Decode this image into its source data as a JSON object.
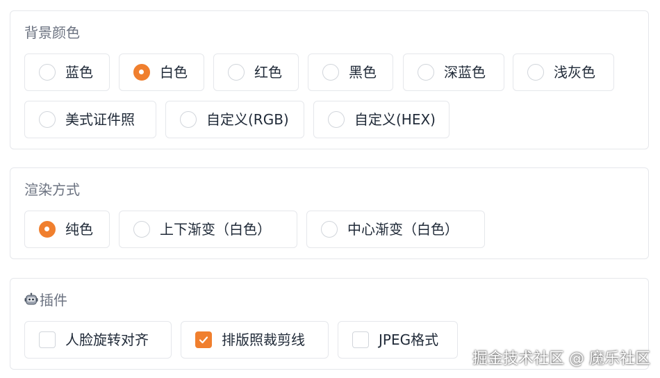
{
  "background_color": {
    "title": "背景颜色",
    "options": [
      "蓝色",
      "白色",
      "红色",
      "黑色",
      "深蓝色",
      "浅灰色",
      "美式证件照",
      "自定义(RGB)",
      "自定义(HEX)"
    ],
    "selected": "白色"
  },
  "render_mode": {
    "title": "渲染方式",
    "options": [
      "纯色",
      "上下渐变（白色）",
      "中心渐变（白色）"
    ],
    "selected": "纯色"
  },
  "plugins": {
    "title": "插件",
    "icon": "robot-icon",
    "options": [
      "人脸旋转对齐",
      "排版照裁剪线",
      "JPEG格式"
    ],
    "checked": [
      "排版照裁剪线"
    ]
  },
  "watermark": "掘金技术社区 @ 魔乐社区",
  "colors": {
    "accent": "#f07f2e",
    "border": "#e5e7eb",
    "muted_text": "#6b7280"
  }
}
